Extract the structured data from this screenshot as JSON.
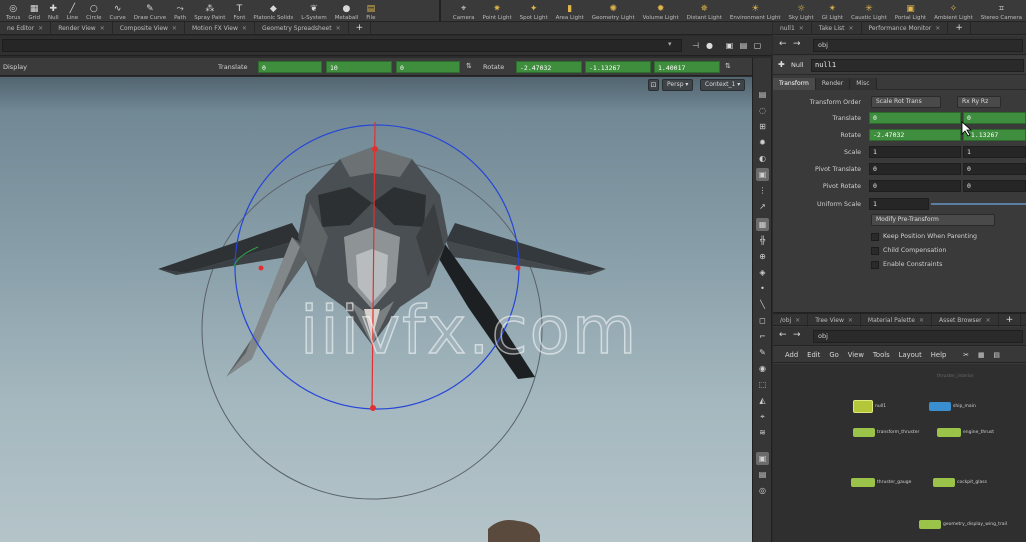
{
  "shelf": {
    "left_tools": [
      {
        "label": "Torus",
        "icon": "torus-icon"
      },
      {
        "label": "Grid",
        "icon": "grid-icon"
      },
      {
        "label": "Null",
        "icon": "null-icon"
      },
      {
        "label": "Line",
        "icon": "line-icon"
      },
      {
        "label": "Circle",
        "icon": "circle-icon"
      },
      {
        "label": "Curve",
        "icon": "curve-icon"
      },
      {
        "label": "Draw Curve",
        "icon": "draw-curve-icon"
      },
      {
        "label": "Path",
        "icon": "path-icon"
      },
      {
        "label": "Spray Paint",
        "icon": "spray-paint-icon"
      },
      {
        "label": "Font",
        "icon": "font-icon"
      },
      {
        "label": "Platonic Solids",
        "icon": "platonic-icon"
      },
      {
        "label": "L-System",
        "icon": "lsystem-icon"
      },
      {
        "label": "Metaball",
        "icon": "metaball-icon"
      },
      {
        "label": "File",
        "icon": "file-icon"
      }
    ],
    "right_tools": [
      {
        "label": "Camera",
        "icon": "camera-icon"
      },
      {
        "label": "Point Light",
        "icon": "point-light-icon"
      },
      {
        "label": "Spot Light",
        "icon": "spot-light-icon"
      },
      {
        "label": "Area Light",
        "icon": "area-light-icon"
      },
      {
        "label": "Geometry Light",
        "icon": "geometry-light-icon"
      },
      {
        "label": "Volume Light",
        "icon": "volume-light-icon"
      },
      {
        "label": "Distant Light",
        "icon": "distant-light-icon"
      },
      {
        "label": "Environment Light",
        "icon": "environment-light-icon"
      },
      {
        "label": "Sky Light",
        "icon": "sky-light-icon"
      },
      {
        "label": "GI Light",
        "icon": "gi-light-icon"
      },
      {
        "label": "Caustic Light",
        "icon": "caustic-light-icon"
      },
      {
        "label": "Portal Light",
        "icon": "portal-light-icon"
      },
      {
        "label": "Ambient Light",
        "icon": "ambient-light-icon"
      },
      {
        "label": "Stereo Camera",
        "icon": "stereo-camera-icon"
      }
    ]
  },
  "tabs": [
    {
      "label": "ne Editor"
    },
    {
      "label": "Render View"
    },
    {
      "label": "Composite View"
    },
    {
      "label": "Motion FX View"
    },
    {
      "label": "Geometry Spreadsheet"
    }
  ],
  "viewport": {
    "mode": "Display",
    "translate_label": "Translate",
    "translate": [
      "0",
      "10",
      "0"
    ],
    "rotate_label": "Rotate",
    "rotate": [
      "-2.47032",
      "-1.13267",
      "1.40017"
    ],
    "persp_label": "Persp ▾",
    "camera_label": "Context_1 ▾",
    "watermark": "iiivfx.com"
  },
  "params": {
    "tabs": [
      {
        "label": "null1"
      },
      {
        "label": "Take List"
      },
      {
        "label": "Performance Monitor"
      }
    ],
    "path": "obj",
    "node_type": "Null",
    "node_name": "null1",
    "param_tabs": [
      {
        "label": "Transform"
      },
      {
        "label": "Render"
      },
      {
        "label": "Misc"
      }
    ],
    "transform_order_label": "Transform Order",
    "transform_order": "Scale Rot Trans",
    "rotate_order": "Rx Ry Rz",
    "translate_label": "Translate",
    "translate": [
      "0",
      "0"
    ],
    "rotate_label": "Rotate",
    "rotate": [
      "-2.47032",
      "-1.13267"
    ],
    "scale_label": "Scale",
    "scale": [
      "1",
      "1"
    ],
    "pivot_translate_label": "Pivot Translate",
    "pivot_translate": [
      "0",
      "0"
    ],
    "pivot_rotate_label": "Pivot Rotate",
    "pivot_rotate": [
      "0",
      "0"
    ],
    "uniform_scale_label": "Uniform Scale",
    "uniform_scale": "1",
    "modify_pre_transform": "Modify Pre-Transform",
    "checks": [
      {
        "label": "Keep Position When Parenting"
      },
      {
        "label": "Child Compensation"
      },
      {
        "label": "Enable Constraints"
      }
    ]
  },
  "network": {
    "tabs": [
      {
        "label": "/obj"
      },
      {
        "label": "Tree View"
      },
      {
        "label": "Material Palette"
      },
      {
        "label": "Asset Browser"
      }
    ],
    "path": "obj",
    "menu": [
      {
        "label": "Add"
      },
      {
        "label": "Edit"
      },
      {
        "label": "Go"
      },
      {
        "label": "View"
      },
      {
        "label": "Tools"
      },
      {
        "label": "Layout"
      },
      {
        "label": "Help"
      }
    ],
    "nodes": [
      {
        "label": "null1"
      },
      {
        "label": "ship_main"
      },
      {
        "label": "transform_thruster"
      },
      {
        "label": "engine_thrust"
      },
      {
        "label": "thruster_gauge"
      },
      {
        "label": "cockpit_glass"
      },
      {
        "label": "thruster_interior"
      },
      {
        "label": "geometry_display_wing_trail"
      }
    ]
  },
  "colors": {
    "accent_green": "#3e8e3e",
    "node_green": "#9bc34a",
    "node_blue": "#3a8fd0",
    "handle_red": "#e23030",
    "handle_blue": "#2646d8"
  }
}
